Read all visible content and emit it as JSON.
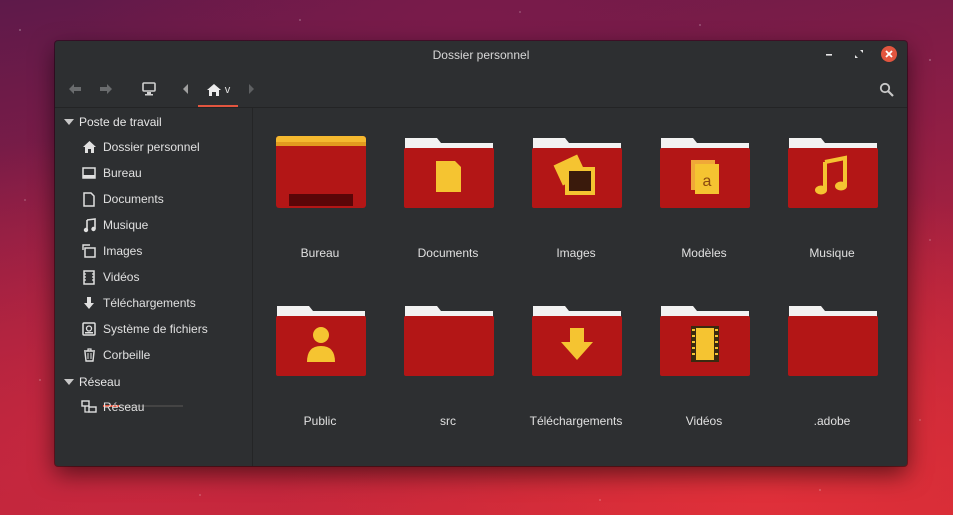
{
  "window": {
    "title": "Dossier personnel"
  },
  "toolbar": {
    "home_menu_indicator": "v"
  },
  "sidebar": {
    "sections": [
      {
        "label": "Poste de travail",
        "items": [
          {
            "label": "Dossier personnel",
            "icon": "home-icon"
          },
          {
            "label": "Bureau",
            "icon": "desktop-icon"
          },
          {
            "label": "Documents",
            "icon": "document-icon"
          },
          {
            "label": "Musique",
            "icon": "music-icon"
          },
          {
            "label": "Images",
            "icon": "image-icon"
          },
          {
            "label": "Vidéos",
            "icon": "video-icon"
          },
          {
            "label": "Téléchargements",
            "icon": "download-icon"
          },
          {
            "label": "Système de fichiers",
            "icon": "drive-icon"
          },
          {
            "label": "Corbeille",
            "icon": "trash-icon"
          }
        ]
      },
      {
        "label": "Réseau",
        "items": [
          {
            "label": "Réseau",
            "icon": "network-icon"
          }
        ]
      }
    ],
    "filesystem_usage_fraction": 0.2
  },
  "files": [
    {
      "label": "Bureau",
      "icon": "desktop-folder-icon"
    },
    {
      "label": "Documents",
      "icon": "documents-folder-icon"
    },
    {
      "label": "Images",
      "icon": "images-folder-icon"
    },
    {
      "label": "Modèles",
      "icon": "templates-folder-icon"
    },
    {
      "label": "Musique",
      "icon": "music-folder-icon"
    },
    {
      "label": "Public",
      "icon": "public-folder-icon"
    },
    {
      "label": "src",
      "icon": "folder-icon"
    },
    {
      "label": "Téléchargements",
      "icon": "downloads-folder-icon"
    },
    {
      "label": "Vidéos",
      "icon": "videos-folder-icon"
    },
    {
      "label": ".adobe",
      "icon": "folder-icon"
    }
  ],
  "colors": {
    "accent": "#e2553f",
    "folder_red": "#b31616",
    "emblem_yellow": "#f5c431",
    "window_bg": "#2d2f31"
  }
}
